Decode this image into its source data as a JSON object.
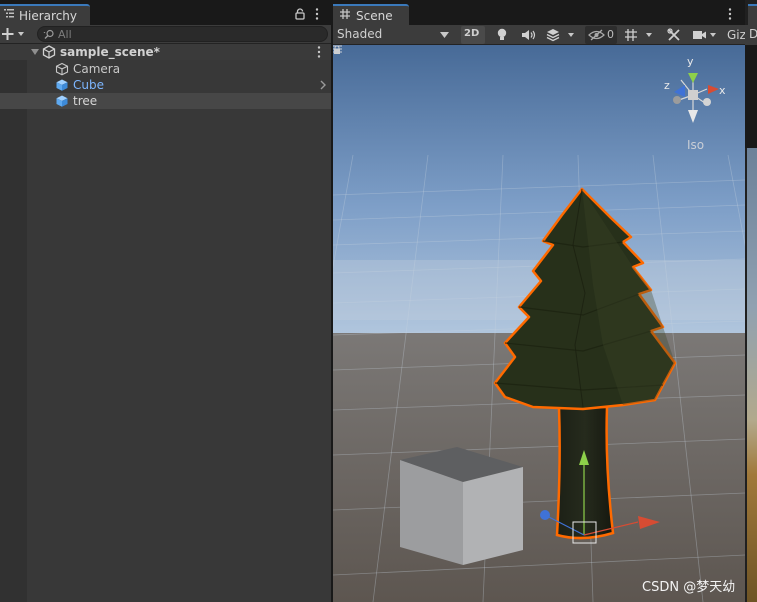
{
  "hierarchy": {
    "tab_label": "Hierarchy",
    "icons": [
      "hierarchy-list-icon",
      "lock-icon",
      "kebab-menu-icon",
      "add-icon",
      "search-icon"
    ],
    "search_placeholder": "All",
    "scene": {
      "name": "sample_scene*",
      "expanded": true
    },
    "items": [
      {
        "label": "Camera",
        "icon": "gameobject-icon",
        "color": "#c8c8c8"
      },
      {
        "label": "Cube",
        "icon": "prefab-cube-icon",
        "color": "#7db6ff",
        "has_children": true
      },
      {
        "label": "tree",
        "icon": "prefab-cube-icon",
        "color": "#d6d6d6",
        "selected": true
      }
    ]
  },
  "scene_view": {
    "tab_label": "Scene",
    "shading_mode": "Shaded",
    "btn_2d": "2D",
    "hidden_count": "0",
    "gizmos_label": "Giz",
    "projection_label": "Iso",
    "gizmo_axes": {
      "x": "x",
      "y": "y",
      "z": "z"
    },
    "selection_color": "#ff6a00",
    "sky_color": "#6f8fb5",
    "ground_color": "#6b645f"
  },
  "right_panel": {
    "toolbar_label": "D"
  },
  "watermark": "CSDN @梦天幼"
}
